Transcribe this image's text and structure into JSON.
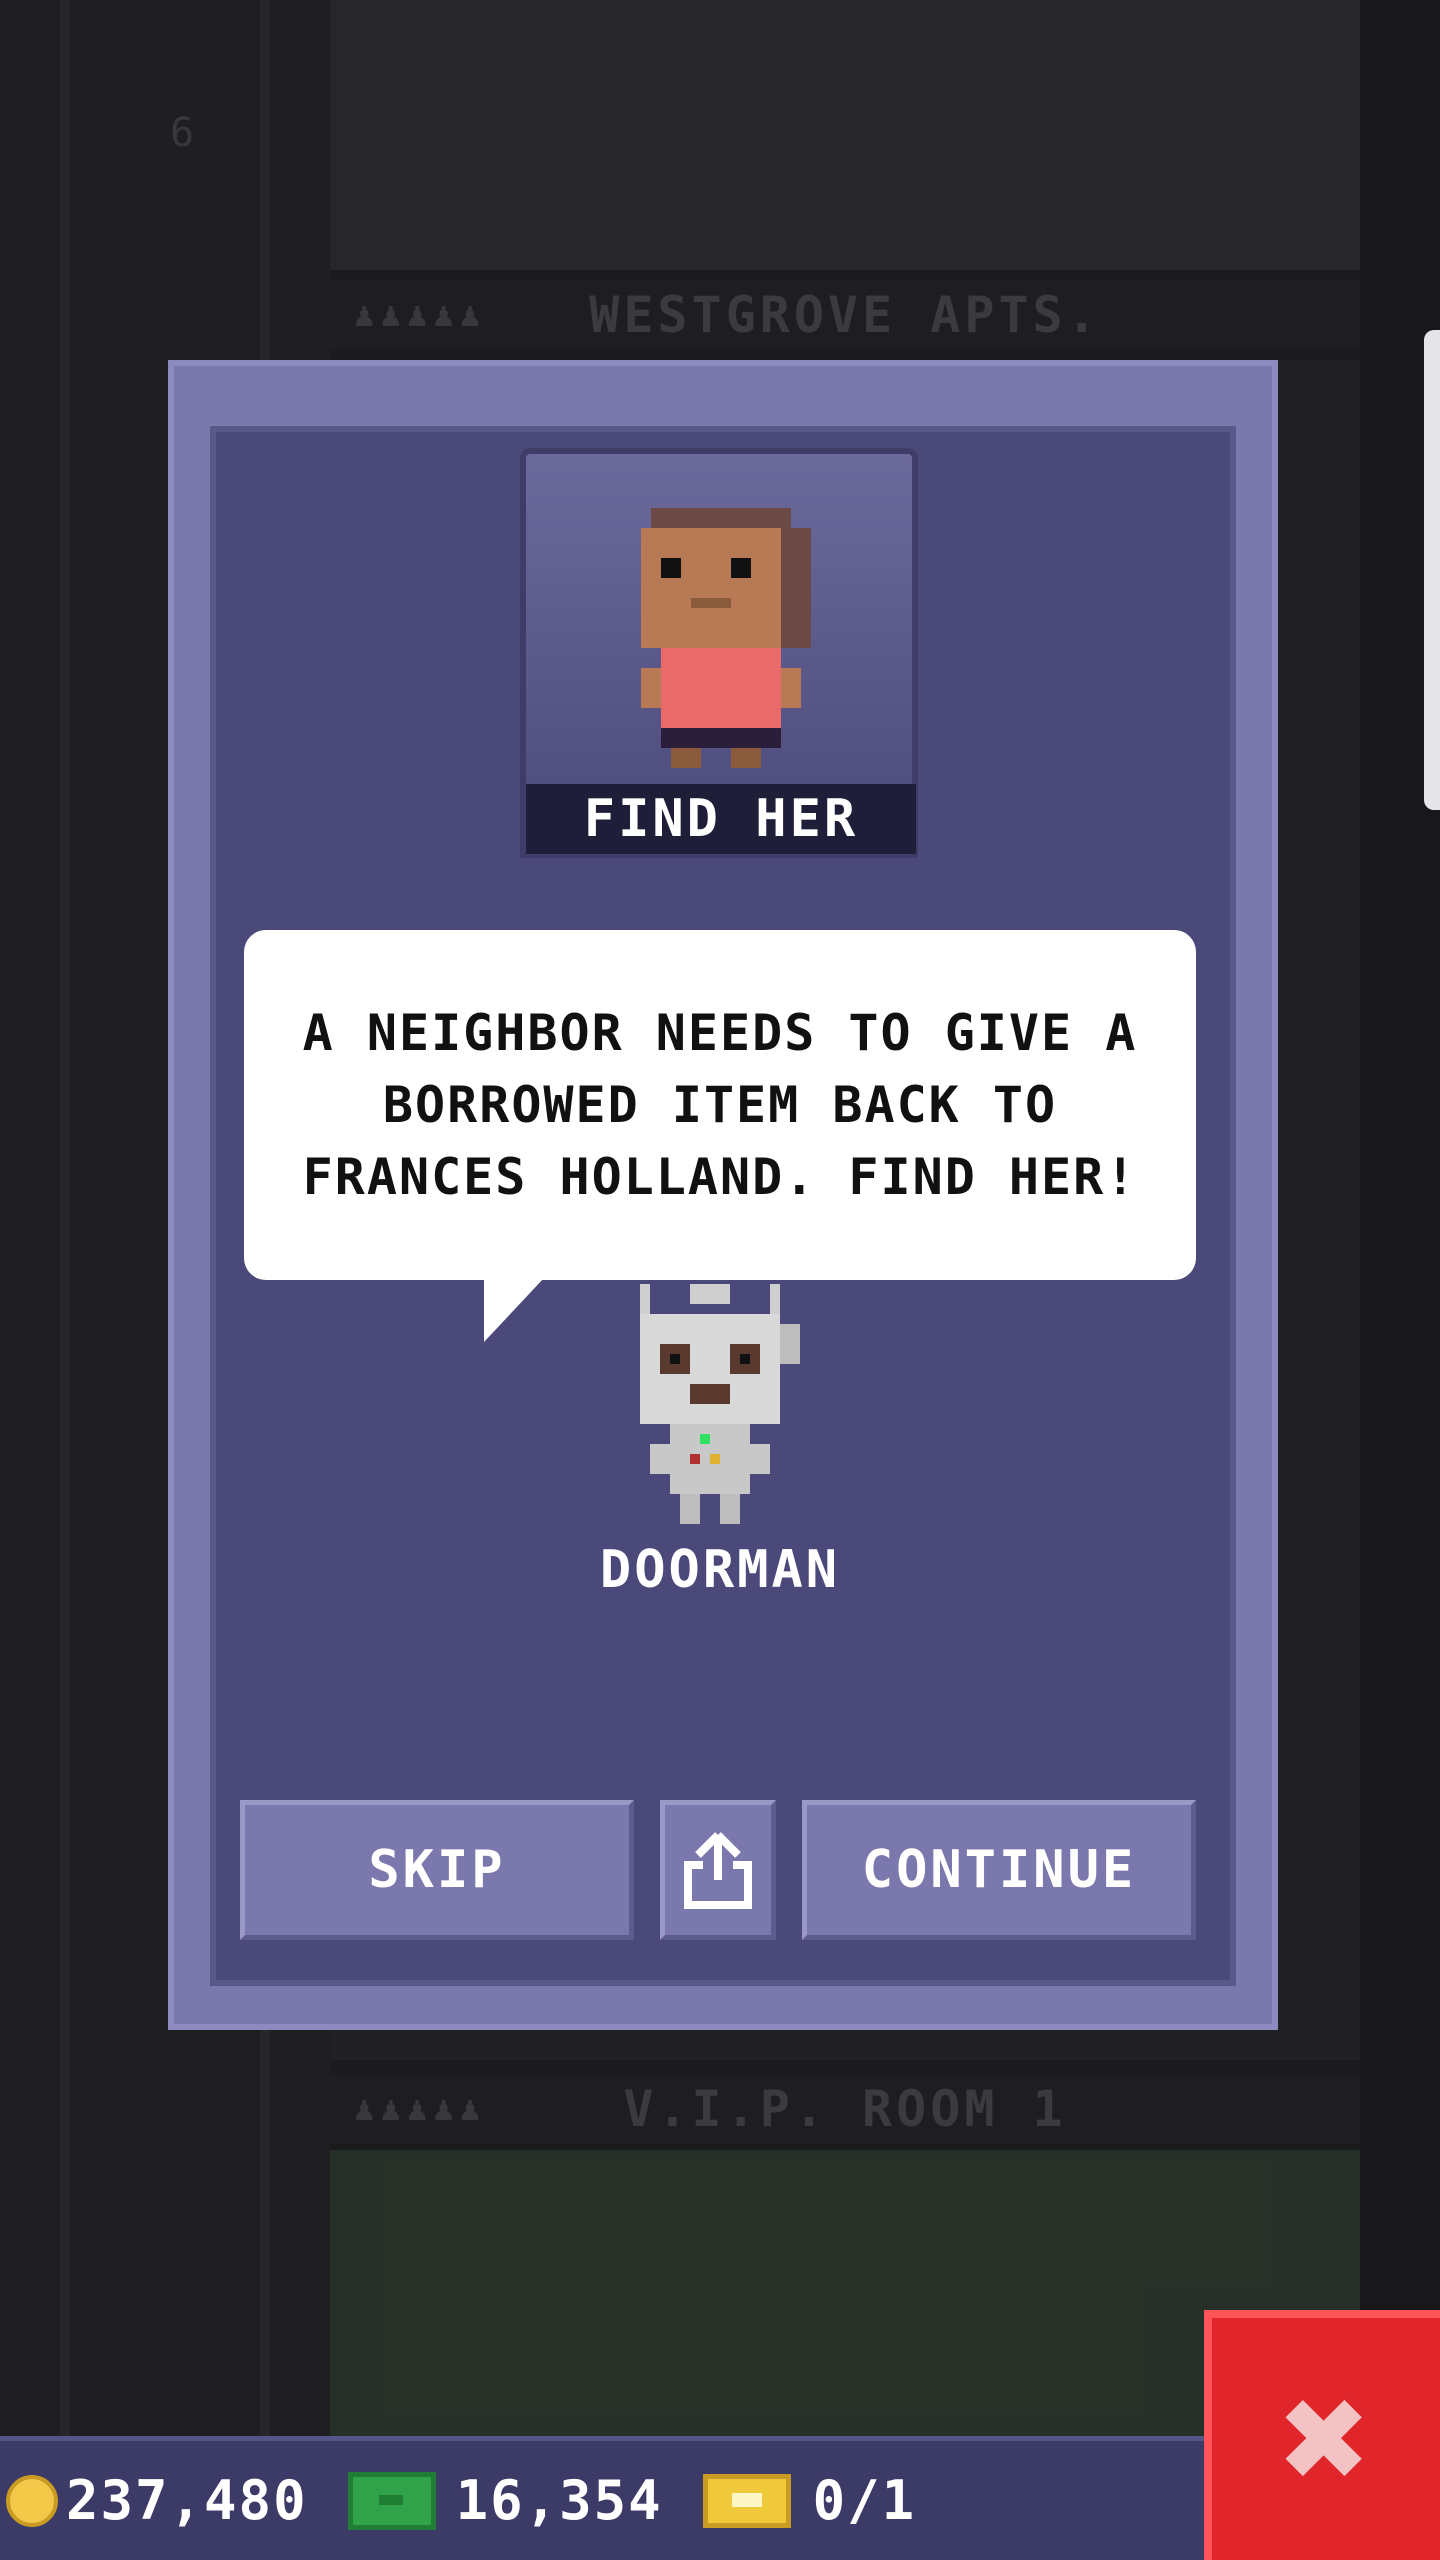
{
  "background": {
    "floor_numbers": [
      "6"
    ],
    "floor_labels": [
      "WESTGROVE APTS.",
      "V.I.P. ROOM 1"
    ],
    "people_icons": "♟♟♟♟♟"
  },
  "dialog": {
    "target_label": "FIND HER",
    "message": "A NEIGHBOR NEEDS TO GIVE A BORROWED ITEM BACK TO FRANCES HOLLAND. FIND HER!",
    "speaker_name": "DOORMAN",
    "buttons": {
      "skip": "SKIP",
      "share_icon": "share-icon",
      "continue": "CONTINUE"
    }
  },
  "hud": {
    "coins": "237,480",
    "bux": "16,354",
    "tickets": "0/1"
  },
  "close_icon": "✖",
  "colors": {
    "dialog_bg": "#4b4979",
    "dialog_border": "#7b78ad",
    "close_red": "#e0262b",
    "coin": "#f3c94a",
    "bux": "#2fa24a"
  }
}
